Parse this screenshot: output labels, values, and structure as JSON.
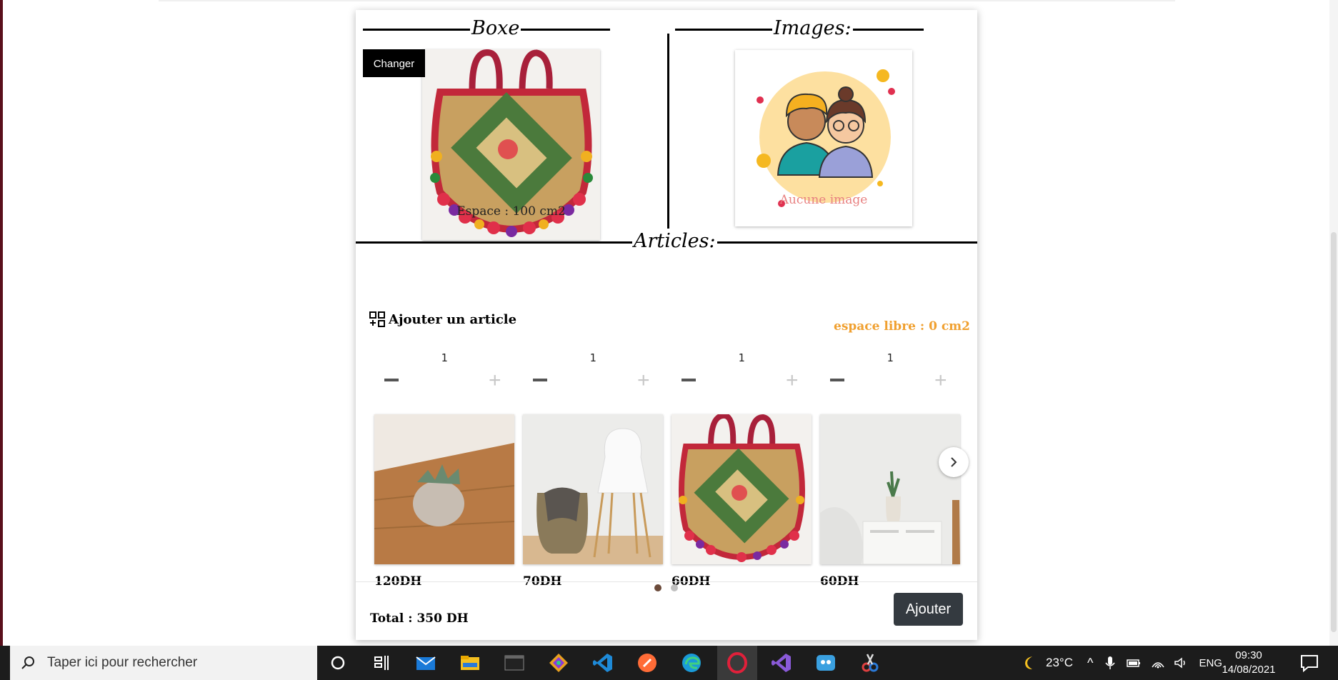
{
  "sections": {
    "boxe_title": "Boxe",
    "images_title": "Images:",
    "articles_title": "Articles:"
  },
  "box": {
    "change_label": "Changer",
    "space_caption": "Espace : 100 cm2"
  },
  "images": {
    "no_image_caption": "Aucune image"
  },
  "articles": {
    "add_label": "Ajouter un article",
    "free_space": "espace libre : 0 cm2",
    "items": [
      {
        "qty": "1",
        "price": "120DH",
        "image": "succulent-pot"
      },
      {
        "qty": "1",
        "price": "70DH",
        "image": "chair-basket"
      },
      {
        "qty": "1",
        "price": "60DH",
        "image": "embroidered-bag"
      },
      {
        "qty": "1",
        "price": "60DH",
        "image": "plant-cabinet"
      }
    ]
  },
  "footer": {
    "total": "Total : 350 DH",
    "submit_label": "Ajouter"
  },
  "taskbar": {
    "search_placeholder": "Taper ici pour rechercher",
    "weather": "23°C",
    "lang": "ENG",
    "time": "09:30",
    "date": "14/08/2021"
  },
  "colors": {
    "free_space": "#f0a030",
    "no_image": "#e88080",
    "submit_bg": "#343a40",
    "active_dot": "#6b4a3a"
  }
}
